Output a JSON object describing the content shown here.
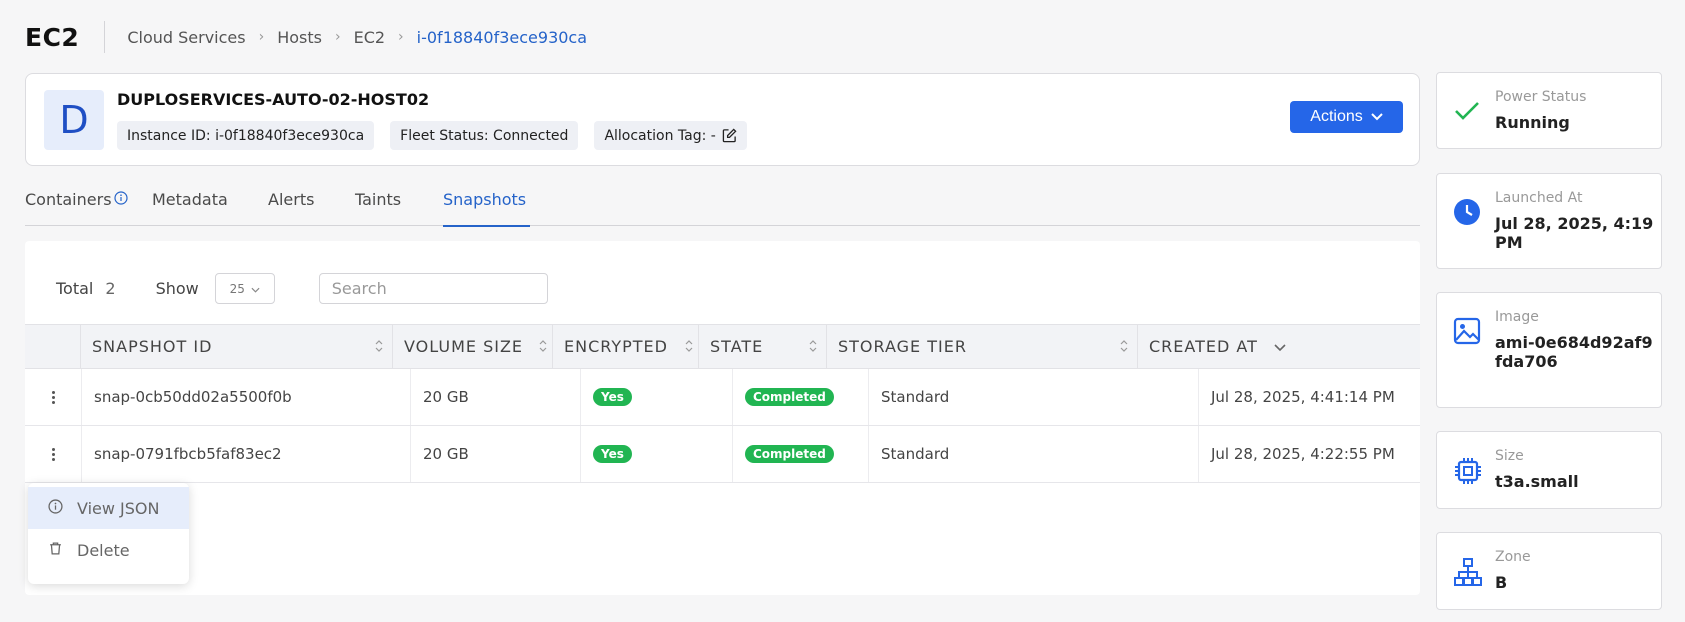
{
  "header": {
    "app_title": "EC2",
    "breadcrumbs": [
      "Cloud Services",
      "Hosts",
      "EC2",
      "i-0f18840f3ece930ca"
    ]
  },
  "host": {
    "avatar_letter": "D",
    "name": "DUPLOSERVICES-AUTO-02-HOST02",
    "instance_id": "Instance ID: i-0f18840f3ece930ca",
    "fleet_status": "Fleet Status: Connected",
    "allocation_tag": "Allocation Tag: -",
    "actions_label": "Actions"
  },
  "tabs": [
    {
      "label": "Containers",
      "active": false
    },
    {
      "label": "Metadata",
      "active": false
    },
    {
      "label": "Alerts",
      "active": false
    },
    {
      "label": "Taints",
      "active": false
    },
    {
      "label": "Snapshots",
      "active": true
    }
  ],
  "toolbar": {
    "total_label": "Total",
    "total_count": "2",
    "show_label": "Show",
    "show_value": "25",
    "search_placeholder": "Search"
  },
  "table": {
    "columns": [
      "SNAPSHOT ID",
      "VOLUME SIZE",
      "ENCRYPTED",
      "STATE",
      "STORAGE TIER",
      "CREATED AT"
    ],
    "rows": [
      {
        "snapshot_id": "snap-0cb50dd02a5500f0b",
        "volume_size": "20 GB",
        "encrypted": "Yes",
        "state": "Completed",
        "storage_tier": "Standard",
        "created_at": "Jul 28, 2025, 4:41:14 PM"
      },
      {
        "snapshot_id": "snap-0791fbcb5faf83ec2",
        "volume_size": "20 GB",
        "encrypted": "Yes",
        "state": "Completed",
        "storage_tier": "Standard",
        "created_at": "Jul 28, 2025, 4:22:55 PM"
      }
    ]
  },
  "context_menu": {
    "items": [
      "View JSON",
      "Delete"
    ]
  },
  "side_cards": [
    {
      "label": "Power Status",
      "value": "Running",
      "icon": "check-icon"
    },
    {
      "label": "Launched At",
      "value": "Jul 28, 2025, 4:19 PM",
      "icon": "clock-icon"
    },
    {
      "label": "Image",
      "value": "ami-0e684d92af9fda706",
      "icon": "image-icon"
    },
    {
      "label": "Size",
      "value": "t3a.small",
      "icon": "cpu-icon"
    },
    {
      "label": "Zone",
      "value": "B",
      "icon": "network-icon"
    }
  ],
  "colors": {
    "accent": "#2566e8",
    "link": "#2563c9",
    "success": "#21b552"
  }
}
